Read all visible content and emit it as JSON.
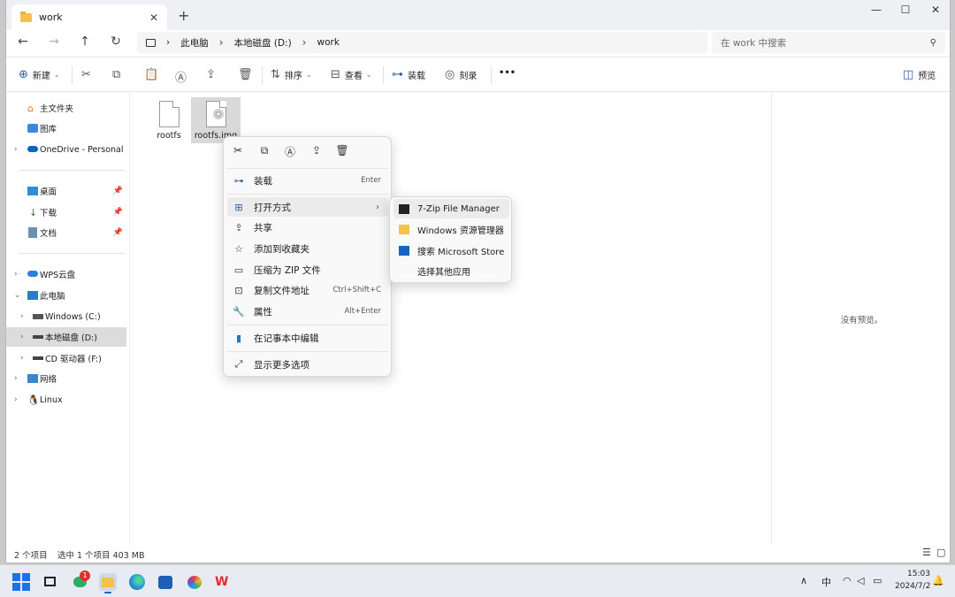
{
  "window": {
    "tab_title": "work",
    "new_tab": "+",
    "controls": {
      "minimize": "—",
      "maximize": "☐",
      "close": "✕"
    }
  },
  "address": {
    "crumbs": [
      "此电脑",
      "本地磁盘 (D:)",
      "work"
    ],
    "search_placeholder": "在 work 中搜索"
  },
  "toolbar": {
    "new_label": "新建",
    "sort_label": "排序",
    "view_label": "查看",
    "mount_label": "装载",
    "burn_label": "刻录",
    "more_label": "•••",
    "preview_label": "预览"
  },
  "sidebar": {
    "home": "主文件夹",
    "gallery": "图库",
    "onedrive": "OneDrive - Personal",
    "desktop": "桌面",
    "downloads": "下载",
    "documents": "文档",
    "wps": "WPS云盘",
    "thispc": "此电脑",
    "drive_c": "Windows (C:)",
    "drive_d": "本地磁盘 (D:)",
    "drive_f": "CD 驱动器 (F:)",
    "network": "网络",
    "linux": "Linux"
  },
  "files": [
    {
      "name": "rootfs"
    },
    {
      "name": "rootfs.img"
    }
  ],
  "preview": {
    "message": "没有预览。"
  },
  "status": {
    "count": "2 个项目",
    "selection": "选中 1 个项目  403 MB"
  },
  "context_menu": {
    "mount": "装载",
    "mount_sc": "Enter",
    "open_with": "打开方式",
    "share": "共享",
    "add_fav": "添加到收藏夹",
    "zip": "压缩为 ZIP 文件",
    "copy_path": "复制文件地址",
    "copy_path_sc": "Ctrl+Shift+C",
    "properties": "属性",
    "properties_sc": "Alt+Enter",
    "notepad": "在记事本中编辑",
    "more_options": "显示更多选项"
  },
  "submenu": {
    "zip7": "7-Zip File Manager",
    "explorer": "Windows 资源管理器",
    "store": "搜索 Microsoft Store",
    "other": "选择其他应用"
  },
  "taskbar": {
    "badge": "1",
    "ime": "中",
    "time": "15:03",
    "date": "2024/7/2"
  },
  "colors": {
    "accent": "#0067c0",
    "selection": "#dcdcdc",
    "folder": "#f3c24c"
  }
}
